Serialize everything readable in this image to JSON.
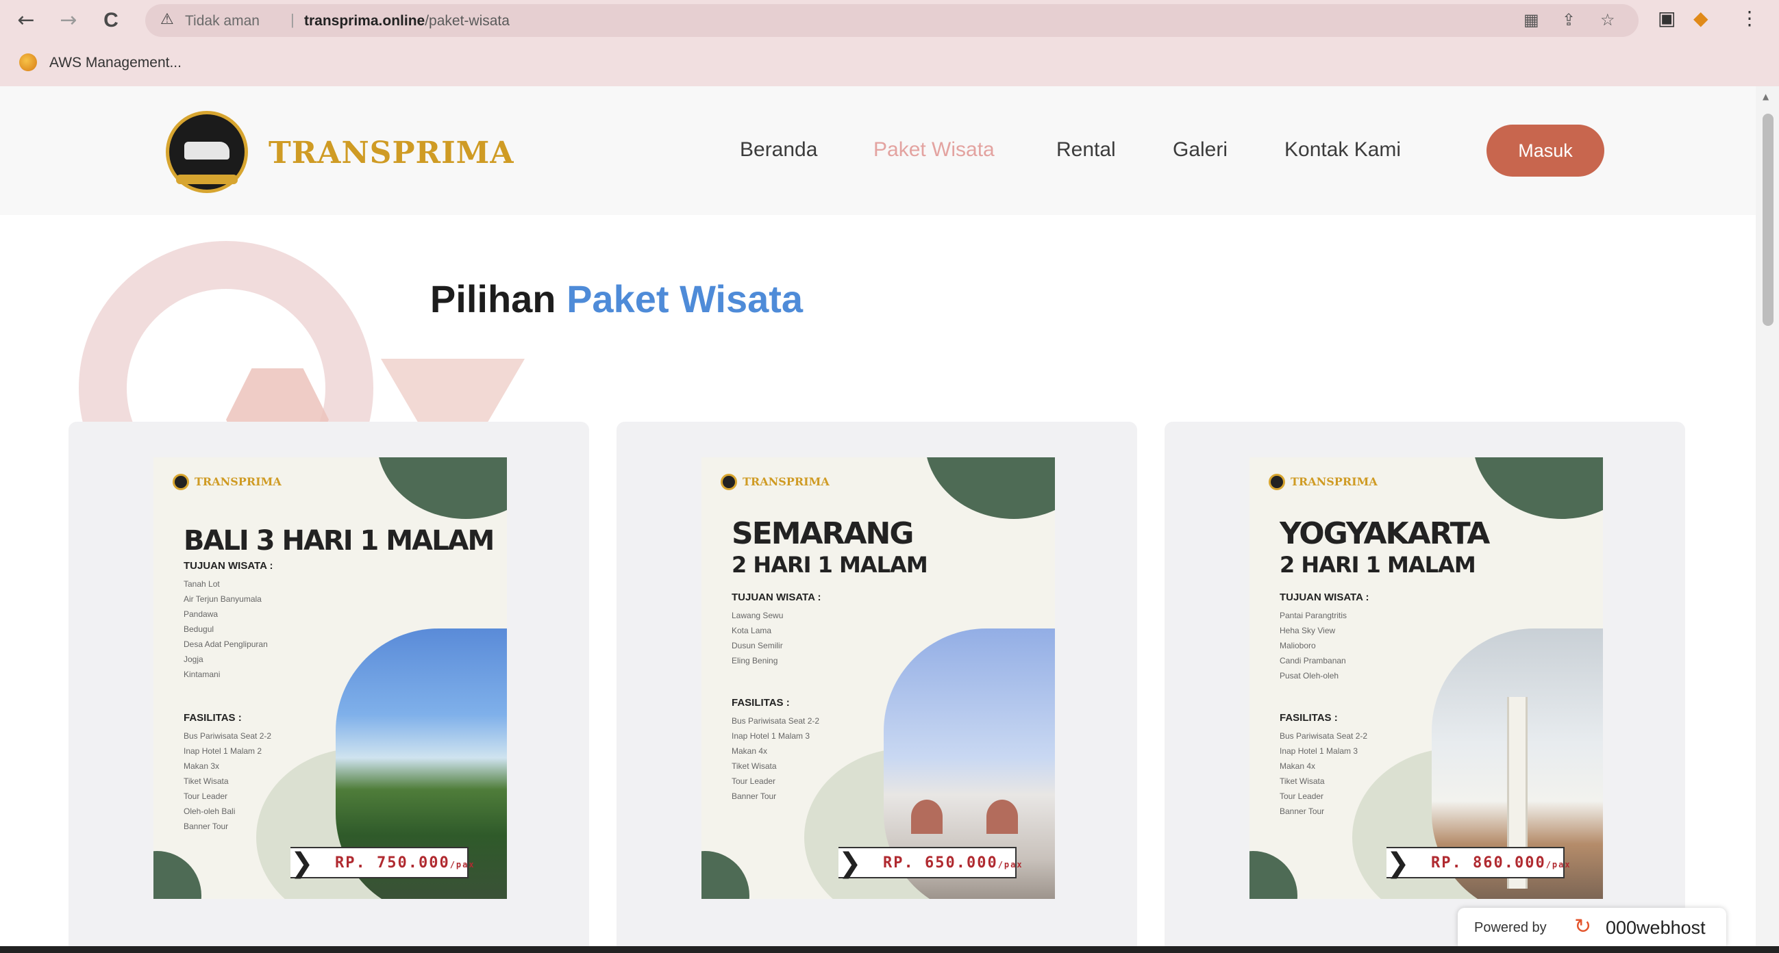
{
  "browser": {
    "nav_back": "←",
    "nav_forward": "→",
    "nav_reload": "C",
    "insecure_label": "Tidak aman",
    "separator": "|",
    "url_domain": "transprima.online",
    "url_path": "/paket-wisata",
    "bookmark_label": "AWS Management..."
  },
  "site": {
    "brand": "TRANSPRIMA",
    "menu": {
      "beranda": "Beranda",
      "paket_wisata": "Paket Wisata",
      "rental": "Rental",
      "galeri": "Galeri",
      "kontak": "Kontak Kami"
    },
    "login_button": "Masuk"
  },
  "section": {
    "title_prefix": "Pilihan",
    "title_highlight": "Paket Wisata"
  },
  "packages": [
    {
      "brand": "TRANSPRIMA",
      "title": "BALI 3 HARI 1 MALAM",
      "subtitle": "",
      "tujuan_label": "TUJUAN WISATA :",
      "tujuan": [
        "Tanah Lot",
        "Air Terjun Banyumala",
        "Pandawa",
        "Bedugul",
        "Desa Adat Penglipuran",
        "Jogja",
        "Kintamani"
      ],
      "fasilitas_label": "FASILITAS :",
      "fasilitas": [
        "Bus Pariwisata Seat 2-2",
        "Inap Hotel 1 Malam 2",
        "Makan 3x",
        "Tiket Wisata",
        "Tour Leader",
        "Oleh-oleh Bali",
        "Banner Tour"
      ],
      "price": "RP. 750.000",
      "price_unit": "/pax"
    },
    {
      "brand": "TRANSPRIMA",
      "title": "SEMARANG",
      "subtitle": "2 HARI 1 MALAM",
      "tujuan_label": "TUJUAN WISATA :",
      "tujuan": [
        "Lawang Sewu",
        "Kota Lama",
        "Dusun Semilir",
        "Eling Bening"
      ],
      "fasilitas_label": "FASILITAS :",
      "fasilitas": [
        "Bus Pariwisata Seat 2-2",
        "Inap Hotel 1 Malam 3",
        "Makan 4x",
        "Tiket Wisata",
        "Tour Leader",
        "Banner Tour"
      ],
      "price": "RP. 650.000",
      "price_unit": "/pax"
    },
    {
      "brand": "TRANSPRIMA",
      "title": "YOGYAKARTA",
      "subtitle": "2 HARI 1 MALAM",
      "tujuan_label": "TUJUAN WISATA :",
      "tujuan": [
        "Pantai Parangtritis",
        "Heha Sky View",
        "Malioboro",
        "Candi Prambanan",
        "Pusat Oleh-oleh"
      ],
      "fasilitas_label": "FASILITAS :",
      "fasilitas": [
        "Bus Pariwisata Seat 2-2",
        "Inap Hotel 1 Malam 3",
        "Makan 4x",
        "Tiket Wisata",
        "Tour Leader",
        "Banner Tour"
      ],
      "price": "RP. 860.000",
      "price_unit": "/pax"
    }
  ],
  "footer_badge": {
    "text": "Powered by",
    "brand": "000webhost"
  },
  "colors": {
    "brand_gold": "#cf9b24",
    "active_menu": "#e3a3a0",
    "login_button": "#c8664e",
    "title_highlight": "#4e8bd8",
    "flyer_green": "#4e6b55",
    "price_red": "#b02a30"
  }
}
